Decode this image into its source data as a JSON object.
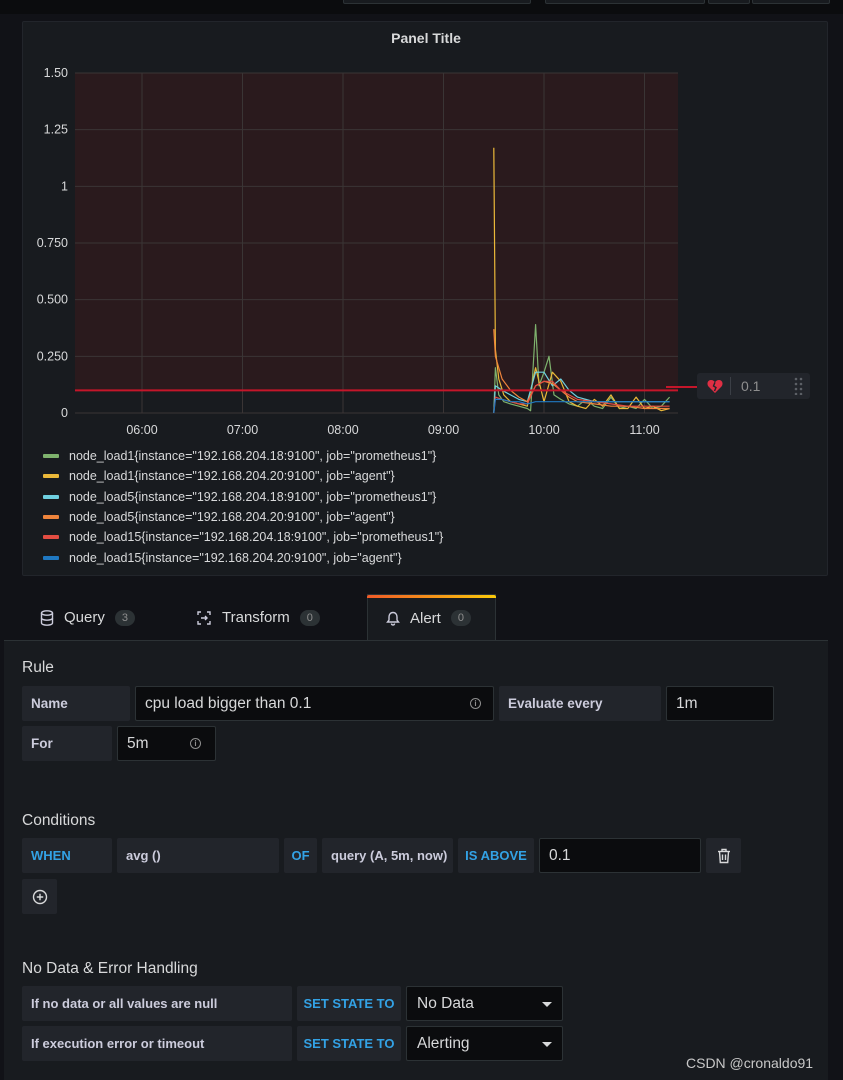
{
  "panel": {
    "title": "Panel Title",
    "threshold_value": "0.1",
    "colors": {
      "threshold": "#c4162a",
      "critical_fill": "#2a1a1d"
    }
  },
  "chart_data": {
    "type": "line",
    "ylim": [
      0,
      1.5
    ],
    "y_ticks": [
      "1.50",
      "1.25",
      "1",
      "0.750",
      "0.500",
      "0.250",
      "0"
    ],
    "x_ticks": [
      "06:00",
      "07:00",
      "08:00",
      "09:00",
      "10:00",
      "11:00"
    ],
    "threshold": 0.1,
    "grid": true,
    "legend_position": "bottom",
    "series": [
      {
        "name": "node_load1{instance=\"192.168.204.18:9100\", job=\"prometheus1\"}",
        "color": "#7eb26d",
        "x": [
          "09:30",
          "09:31",
          "09:33",
          "09:36",
          "09:40",
          "09:45",
          "09:50",
          "09:52",
          "09:55",
          "09:57",
          "10:00",
          "10:03",
          "10:06",
          "10:10",
          "10:15",
          "10:20",
          "10:25",
          "10:30",
          "10:35",
          "10:40",
          "10:45",
          "10:50",
          "10:55",
          "11:00",
          "11:05",
          "11:10",
          "11:15"
        ],
        "values": [
          0.0,
          0.2,
          0.08,
          0.05,
          0.04,
          0.03,
          0.02,
          0.01,
          0.39,
          0.12,
          0.18,
          0.25,
          0.08,
          0.06,
          0.04,
          0.03,
          0.06,
          0.03,
          0.02,
          0.07,
          0.02,
          0.03,
          0.02,
          0.06,
          0.02,
          0.03,
          0.07
        ]
      },
      {
        "name": "node_load1{instance=\"192.168.204.20:9100\", job=\"agent\"}",
        "color": "#eab839",
        "x": [
          "09:30",
          "09:31",
          "09:33",
          "09:36",
          "09:40",
          "09:45",
          "09:50",
          "09:55",
          "10:00",
          "10:05",
          "10:10",
          "10:15",
          "10:20",
          "10:25",
          "10:30",
          "10:35",
          "10:40",
          "10:45",
          "10:50",
          "10:55",
          "11:00",
          "11:05",
          "11:10",
          "11:15"
        ],
        "values": [
          1.17,
          0.28,
          0.15,
          0.08,
          0.05,
          0.04,
          0.03,
          0.2,
          0.05,
          0.18,
          0.14,
          0.05,
          0.03,
          0.02,
          0.06,
          0.03,
          0.08,
          0.02,
          0.02,
          0.07,
          0.02,
          0.03,
          0.01,
          0.02
        ]
      },
      {
        "name": "node_load5{instance=\"192.168.204.18:9100\", job=\"prometheus1\"}",
        "color": "#6ed0e0",
        "x": [
          "09:30",
          "09:31",
          "09:35",
          "09:40",
          "09:45",
          "09:50",
          "09:55",
          "10:00",
          "10:05",
          "10:10",
          "10:15",
          "10:20",
          "10:30",
          "10:40",
          "10:50",
          "11:00",
          "11:10",
          "11:15"
        ],
        "values": [
          0.0,
          0.12,
          0.1,
          0.08,
          0.06,
          0.05,
          0.18,
          0.18,
          0.12,
          0.15,
          0.1,
          0.07,
          0.05,
          0.05,
          0.05,
          0.05,
          0.05,
          0.05
        ]
      },
      {
        "name": "node_load5{instance=\"192.168.204.20:9100\", job=\"agent\"}",
        "color": "#ef843c",
        "x": [
          "09:30",
          "09:31",
          "09:35",
          "09:40",
          "09:45",
          "09:50",
          "09:55",
          "10:00",
          "10:05",
          "10:10",
          "10:15",
          "10:20",
          "10:30",
          "10:40",
          "10:50",
          "11:00",
          "11:10",
          "11:15"
        ],
        "values": [
          0.37,
          0.25,
          0.15,
          0.1,
          0.07,
          0.05,
          0.12,
          0.14,
          0.13,
          0.1,
          0.07,
          0.05,
          0.04,
          0.03,
          0.03,
          0.02,
          0.02,
          0.02
        ]
      },
      {
        "name": "node_load15{instance=\"192.168.204.18:9100\", job=\"prometheus1\"}",
        "color": "#e24d42",
        "x": [
          "09:30",
          "09:31",
          "09:35",
          "09:40",
          "09:45",
          "09:50",
          "09:55",
          "10:00",
          "10:05",
          "10:10",
          "10:15",
          "10:20",
          "10:30",
          "10:40",
          "10:50",
          "11:00",
          "11:10",
          "11:15"
        ],
        "values": [
          0.0,
          0.07,
          0.06,
          0.05,
          0.04,
          0.04,
          0.12,
          0.14,
          0.14,
          0.1,
          0.08,
          0.06,
          0.05,
          0.04,
          0.03,
          0.03,
          0.03,
          0.03
        ]
      },
      {
        "name": "node_load15{instance=\"192.168.204.20:9100\", job=\"agent\"}",
        "color": "#1f78c1",
        "x": [
          "09:30",
          "09:31",
          "09:35",
          "09:40",
          "09:45",
          "09:50",
          "09:55",
          "10:00",
          "10:05",
          "10:10",
          "10:15",
          "10:20",
          "10:30",
          "10:40",
          "10:50",
          "11:00",
          "11:10",
          "11:15"
        ],
        "values": [
          0.0,
          0.06,
          0.06,
          0.05,
          0.05,
          0.04,
          0.05,
          0.05,
          0.05,
          0.05,
          0.05,
          0.05,
          0.05,
          0.05,
          0.05,
          0.05,
          0.05,
          0.05
        ]
      }
    ]
  },
  "tabs": [
    {
      "label": "Query",
      "count": "3",
      "icon": "database-icon"
    },
    {
      "label": "Transform",
      "count": "0",
      "icon": "transform-icon"
    },
    {
      "label": "Alert",
      "count": "0",
      "icon": "bell-icon"
    }
  ],
  "rule": {
    "heading": "Rule",
    "name_label": "Name",
    "name_value": "cpu load bigger than 0.1",
    "evaluate_label": "Evaluate every",
    "evaluate_value": "1m",
    "for_label": "For",
    "for_value": "5m"
  },
  "conditions": {
    "heading": "Conditions",
    "when": "WHEN",
    "reducer": "avg ()",
    "of": "OF",
    "query": "query (A, 5m, now)",
    "evaluator": "IS ABOVE",
    "threshold": "0.1"
  },
  "nodata": {
    "heading": "No Data & Error Handling",
    "row1_label": "If no data or all values are null",
    "row1_action": "SET STATE TO",
    "row1_value": "No Data",
    "row2_label": "If execution error or timeout",
    "row2_action": "SET STATE TO",
    "row2_value": "Alerting"
  },
  "watermark": "CSDN @cronaldo91"
}
